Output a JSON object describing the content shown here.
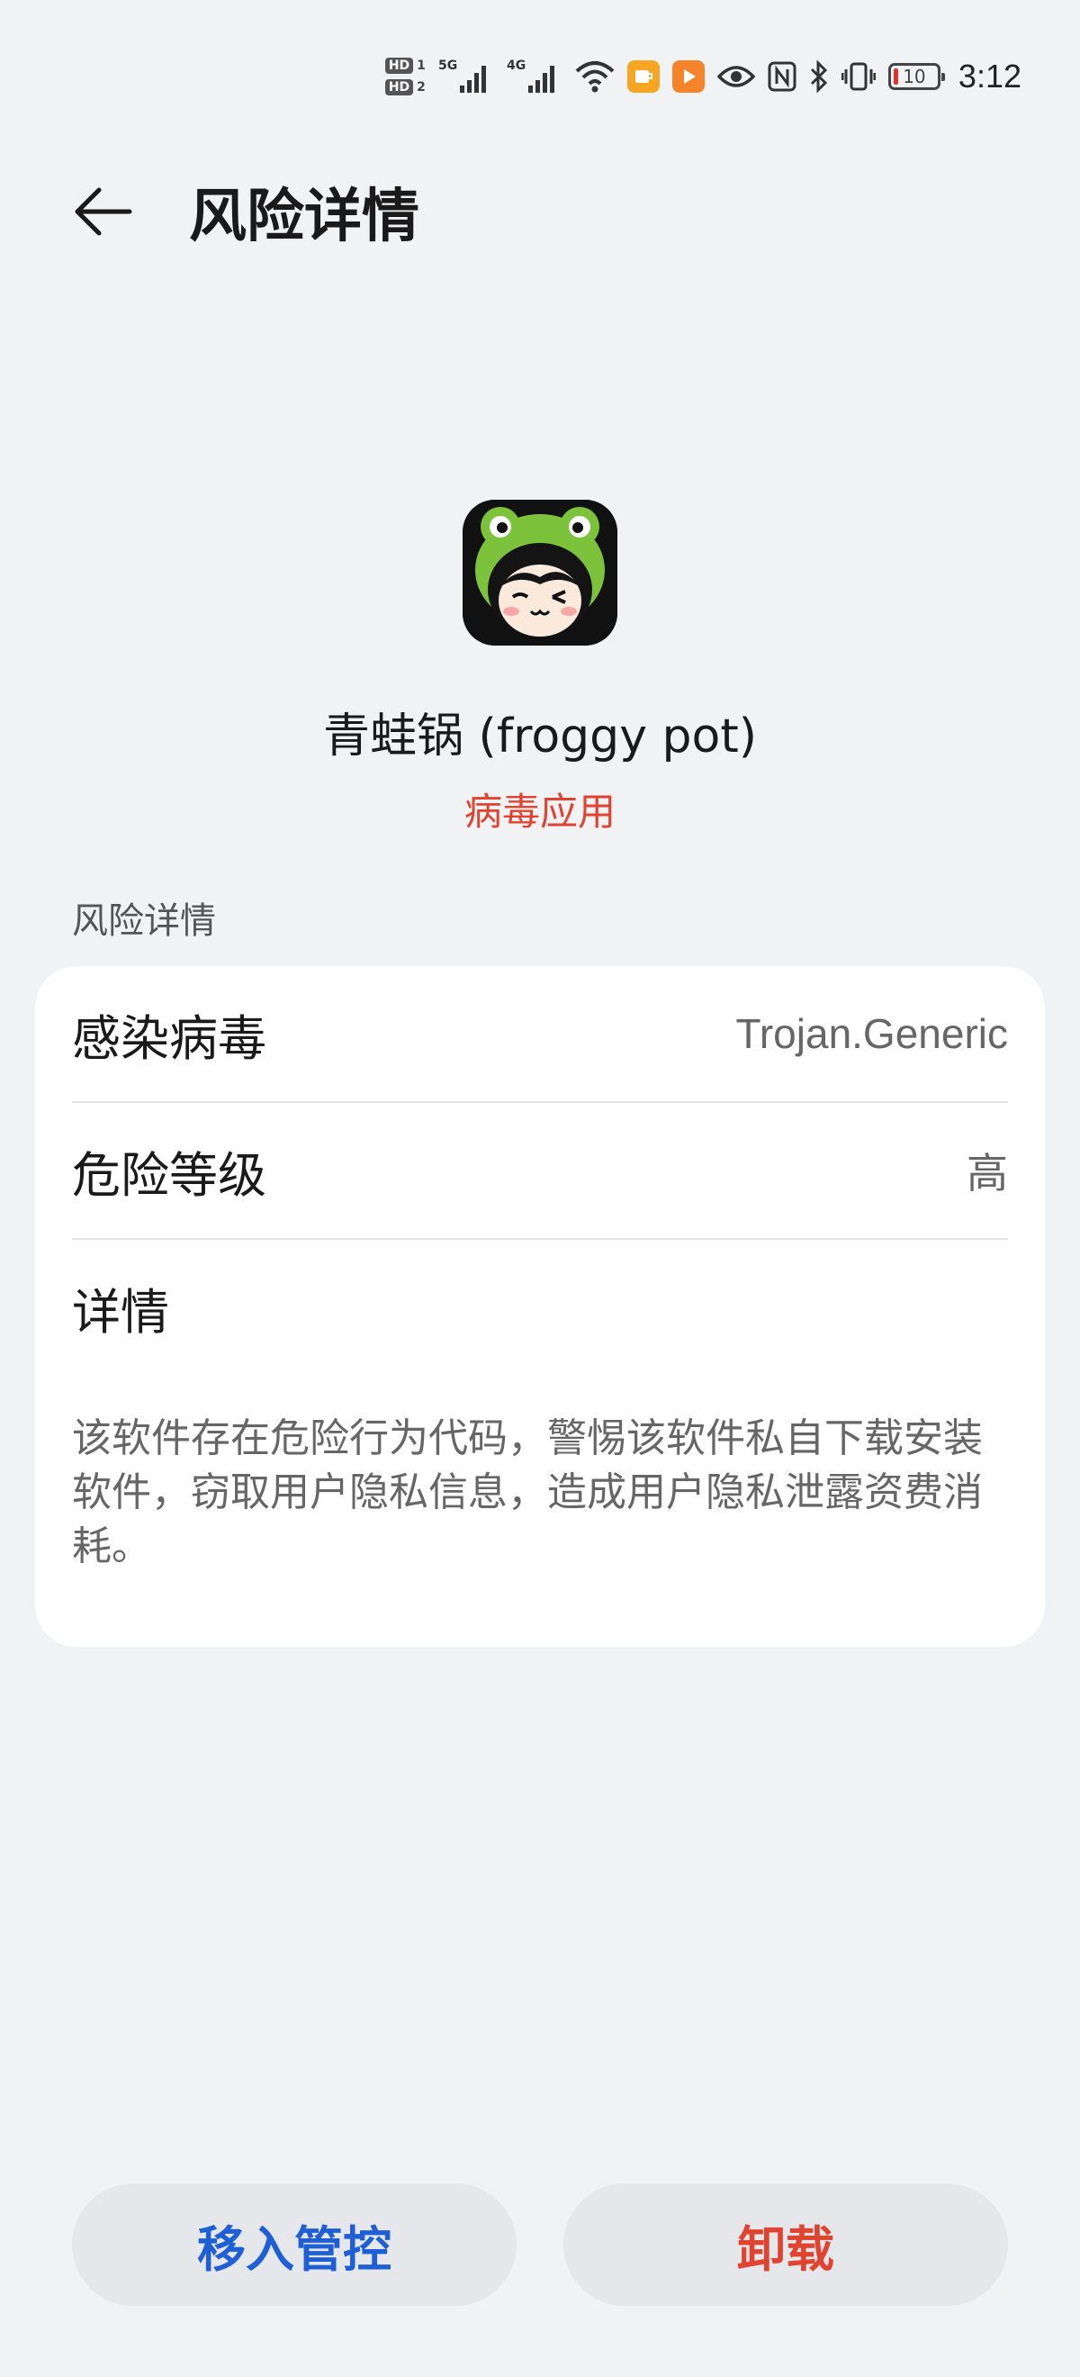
{
  "status_bar": {
    "hd1": "HD",
    "hd1_num": "1",
    "hd2": "HD",
    "hd2_num": "2",
    "signal1": "5G",
    "signal2": "4G",
    "battery": "10",
    "time": "3:12",
    "icons": [
      "signal-5g-icon",
      "signal-4g-icon",
      "wifi-icon",
      "notification-app-icon",
      "video-app-icon",
      "eye-icon",
      "nfc-icon",
      "bluetooth-icon",
      "vibrate-icon",
      "battery-icon"
    ],
    "colors": {
      "battery_low": "#e0322a",
      "notif_orange": "#f6a623",
      "video_orange": "#f5832a"
    }
  },
  "header": {
    "title": "风险详情",
    "back_icon": "arrow-left-icon"
  },
  "app": {
    "name": "青蛙锅 (froggy pot)",
    "tag": "病毒应用",
    "tag_color": "#e0432f"
  },
  "section": {
    "label": "风险详情"
  },
  "details": {
    "rows": [
      {
        "label": "感染病毒",
        "value": "Trojan.Generic"
      },
      {
        "label": "危险等级",
        "value": "高"
      },
      {
        "label": "详情",
        "value": ""
      }
    ],
    "description": "该软件存在危险行为代码，警惕该软件私自下载安装软件，窃取用户隐私信息，造成用户隐私泄露资费消耗。"
  },
  "buttons": {
    "manage": "移入管控",
    "uninstall": "卸载",
    "manage_color": "#1f5fd6",
    "uninstall_color": "#e0432f"
  }
}
